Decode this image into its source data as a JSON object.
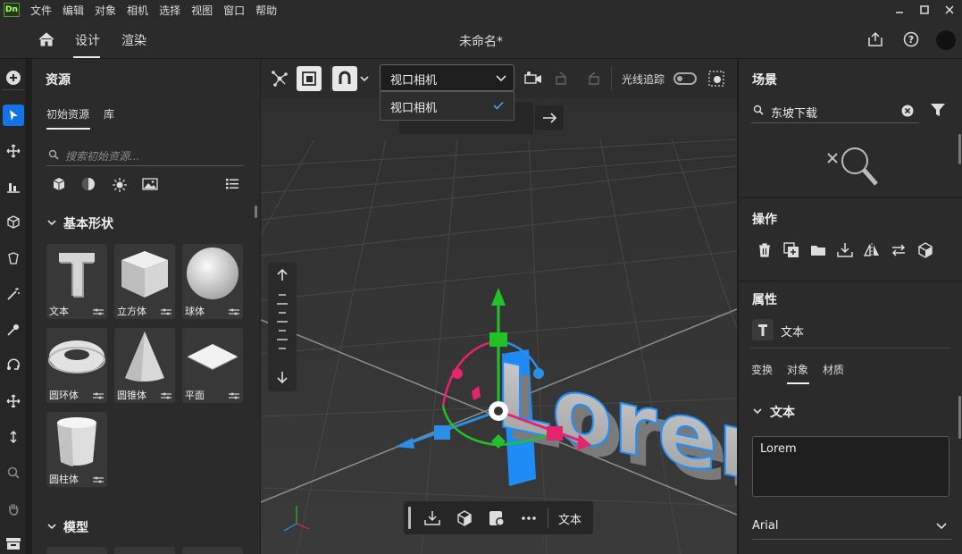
{
  "menubar": {
    "logo": "Dn",
    "items": [
      "文件",
      "编辑",
      "对象",
      "相机",
      "选择",
      "视图",
      "窗口",
      "帮助"
    ],
    "window_controls": [
      "minimize-icon",
      "maximize-icon",
      "close-icon"
    ]
  },
  "header": {
    "tabs": [
      "设计",
      "渲染"
    ],
    "active_tab": "设计",
    "document_title": "未命名*"
  },
  "assets": {
    "title": "资源",
    "tabs": [
      "初始资源",
      "库"
    ],
    "active_tab": "初始资源",
    "search_placeholder": "搜索初始资源...",
    "filter_icons": [
      "cube-icon",
      "material-sphere-icon",
      "light-icon",
      "image-icon",
      "list-view-icon"
    ],
    "sections": [
      {
        "title": "基本形状",
        "items": [
          "文本",
          "立方体",
          "球体",
          "圆环体",
          "圆锥体",
          "平面",
          "圆柱体"
        ]
      },
      {
        "title": "模型"
      }
    ]
  },
  "viewport": {
    "camera_select": {
      "value": "视口相机",
      "options": [
        "视口相机"
      ],
      "selected": "视口相机"
    },
    "raytrace_label": "光线追踪",
    "raytrace_on": false,
    "scene_text": "Lorem",
    "bottom_bar_label": "文本"
  },
  "scene": {
    "title": "场景",
    "search_value": "东坡下载"
  },
  "operations": {
    "title": "操作",
    "icons": [
      "delete-icon",
      "duplicate-icon",
      "group-folder-icon",
      "drop-to-ground-icon",
      "mirror-icon",
      "swap-icon",
      "convert-to-3d-icon"
    ]
  },
  "properties": {
    "title": "属性",
    "object_type": "文本",
    "tabs": [
      "变换",
      "对象",
      "材质"
    ],
    "active_tab": "对象",
    "section": "文本",
    "text_value": "Lorem",
    "font": "Arial"
  },
  "colors": {
    "accent": "#1473e6",
    "gizmo_green": "#22c12a",
    "gizmo_pink": "#e6246e",
    "gizmo_blue": "#2b8fe6",
    "text_outline": "#1e90ff"
  }
}
